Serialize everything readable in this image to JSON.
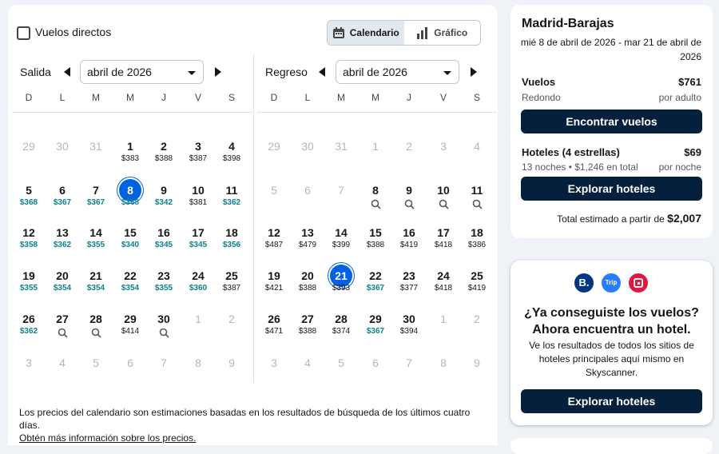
{
  "filters": {
    "direct_flights_label": "Vuelos directos",
    "direct_flights_checked": false
  },
  "view_toggle": {
    "calendar_label": "Calendario",
    "chart_label": "Gráfico",
    "active": "calendar"
  },
  "weekdays": [
    "D",
    "L",
    "M",
    "M",
    "J",
    "V",
    "S"
  ],
  "departure": {
    "label": "Salida",
    "month": "abril de 2026",
    "weeks": [
      [
        {
          "d": "29",
          "m": true
        },
        {
          "d": "30",
          "m": true
        },
        {
          "d": "31",
          "m": true
        },
        {
          "d": "1",
          "p": "$383"
        },
        {
          "d": "2",
          "p": "$388"
        },
        {
          "d": "3",
          "p": "$387"
        },
        {
          "d": "4",
          "p": "$398"
        }
      ],
      [
        {
          "d": "5",
          "p": "$368",
          "g": true
        },
        {
          "d": "6",
          "p": "$367",
          "g": true
        },
        {
          "d": "7",
          "p": "$367",
          "g": true
        },
        {
          "d": "8",
          "p": "$368",
          "g": true,
          "s": true
        },
        {
          "d": "9",
          "p": "$342",
          "g": true
        },
        {
          "d": "10",
          "p": "$381"
        },
        {
          "d": "11",
          "p": "$362",
          "g": true
        }
      ],
      [
        {
          "d": "12",
          "p": "$358",
          "g": true
        },
        {
          "d": "13",
          "p": "$362",
          "g": true
        },
        {
          "d": "14",
          "p": "$355",
          "g": true
        },
        {
          "d": "15",
          "p": "$340",
          "g": true
        },
        {
          "d": "16",
          "p": "$345",
          "g": true
        },
        {
          "d": "17",
          "p": "$345",
          "g": true
        },
        {
          "d": "18",
          "p": "$356",
          "g": true
        }
      ],
      [
        {
          "d": "19",
          "p": "$355",
          "g": true
        },
        {
          "d": "20",
          "p": "$354",
          "g": true
        },
        {
          "d": "21",
          "p": "$354",
          "g": true
        },
        {
          "d": "22",
          "p": "$354",
          "g": true
        },
        {
          "d": "23",
          "p": "$355",
          "g": true
        },
        {
          "d": "24",
          "p": "$360",
          "g": true
        },
        {
          "d": "25",
          "p": "$387"
        }
      ],
      [
        {
          "d": "26",
          "p": "$362",
          "g": true
        },
        {
          "d": "27",
          "q": true
        },
        {
          "d": "28",
          "q": true
        },
        {
          "d": "29",
          "p": "$414"
        },
        {
          "d": "30",
          "q": true
        },
        {
          "d": "1",
          "m": true
        },
        {
          "d": "2",
          "m": true
        }
      ],
      [
        {
          "d": "3",
          "m": true
        },
        {
          "d": "4",
          "m": true
        },
        {
          "d": "5",
          "m": true
        },
        {
          "d": "6",
          "m": true
        },
        {
          "d": "7",
          "m": true
        },
        {
          "d": "8",
          "m": true
        },
        {
          "d": "9",
          "m": true
        }
      ]
    ]
  },
  "return": {
    "label": "Regreso",
    "month": "abril de 2026",
    "weeks": [
      [
        {
          "d": "29",
          "m": true
        },
        {
          "d": "30",
          "m": true
        },
        {
          "d": "31",
          "m": true
        },
        {
          "d": "1",
          "m": true
        },
        {
          "d": "2",
          "m": true
        },
        {
          "d": "3",
          "m": true
        },
        {
          "d": "4",
          "m": true
        }
      ],
      [
        {
          "d": "5",
          "m": true
        },
        {
          "d": "6",
          "m": true
        },
        {
          "d": "7",
          "m": true
        },
        {
          "d": "8",
          "q": true
        },
        {
          "d": "9",
          "q": true
        },
        {
          "d": "10",
          "q": true
        },
        {
          "d": "11",
          "q": true
        }
      ],
      [
        {
          "d": "12",
          "p": "$487"
        },
        {
          "d": "13",
          "p": "$479"
        },
        {
          "d": "14",
          "p": "$399"
        },
        {
          "d": "15",
          "p": "$388"
        },
        {
          "d": "16",
          "p": "$419"
        },
        {
          "d": "17",
          "p": "$418"
        },
        {
          "d": "18",
          "p": "$386"
        }
      ],
      [
        {
          "d": "19",
          "p": "$421"
        },
        {
          "d": "20",
          "p": "$388"
        },
        {
          "d": "21",
          "p": "$393",
          "s": true
        },
        {
          "d": "22",
          "p": "$367",
          "g": true
        },
        {
          "d": "23",
          "p": "$377"
        },
        {
          "d": "24",
          "p": "$418"
        },
        {
          "d": "25",
          "p": "$419"
        }
      ],
      [
        {
          "d": "26",
          "p": "$471"
        },
        {
          "d": "27",
          "p": "$388"
        },
        {
          "d": "28",
          "p": "$374"
        },
        {
          "d": "29",
          "p": "$367",
          "g": true
        },
        {
          "d": "30",
          "p": "$394"
        },
        {
          "d": "1",
          "m": true
        },
        {
          "d": "2",
          "m": true
        }
      ],
      [
        {
          "d": "3",
          "m": true
        },
        {
          "d": "4",
          "m": true
        },
        {
          "d": "5",
          "m": true
        },
        {
          "d": "6",
          "m": true
        },
        {
          "d": "7",
          "m": true
        },
        {
          "d": "8",
          "m": true
        },
        {
          "d": "9",
          "m": true
        }
      ]
    ]
  },
  "note": {
    "text": "Los precios del calendario son estimaciones basadas en los resultados de búsqueda de los últimos cuatro días.",
    "link": "Obtén más información sobre los precios."
  },
  "summary": {
    "route": "Madrid-Barajas",
    "dates": "mié 8 de abril de 2026 - mar 21 de abril de 2026",
    "flights_label": "Vuelos",
    "flights_price": "$761",
    "flights_sub": "Redondo",
    "flights_unit": "por adulto",
    "find_flights": "Encontrar vuelos",
    "hotels_label": "Hoteles (4 estrellas)",
    "hotels_price": "$69",
    "hotels_sub": "13 noches • $1,246 en total",
    "hotels_unit": "por noche",
    "explore_hotels": "Explorar hoteles",
    "total_label": "Total estimado a partir de",
    "total_value": "$2,007"
  },
  "promo": {
    "logos": [
      {
        "name": "booking-logo",
        "text": "B.",
        "color": "#003580"
      },
      {
        "name": "trip-logo",
        "text": "Trip",
        "color": "#287dfa"
      },
      {
        "name": "agoda-logo",
        "text": "",
        "color": "#e2173d"
      }
    ],
    "title": "¿Ya conseguiste los vuelos? Ahora encuentra un hotel.",
    "text": "Ve los resultados de todos los sitios de hoteles principales aquí mismo en Skyscanner.",
    "button": "Explorar hoteles"
  },
  "colors": {
    "accent": "#0062e3",
    "dark_button": "#05203c",
    "good_price": "#0c838a"
  }
}
